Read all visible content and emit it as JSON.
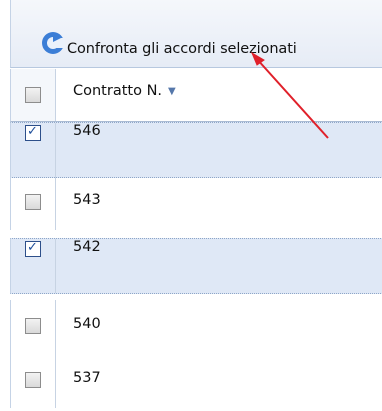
{
  "toolbar": {
    "compare_label": "Confronta gli accordi selezionati",
    "compare_icon": "refresh-arrow-icon"
  },
  "grid": {
    "column_header": "Contratto N.",
    "sort_icon": "sort-desc-icon",
    "rows": [
      {
        "number": "546",
        "checked": true
      },
      {
        "number": "543",
        "checked": false
      },
      {
        "number": "542",
        "checked": true
      },
      {
        "number": "540",
        "checked": false
      },
      {
        "number": "537",
        "checked": false
      }
    ]
  },
  "annotation": {
    "arrow_color": "#e0202a"
  }
}
